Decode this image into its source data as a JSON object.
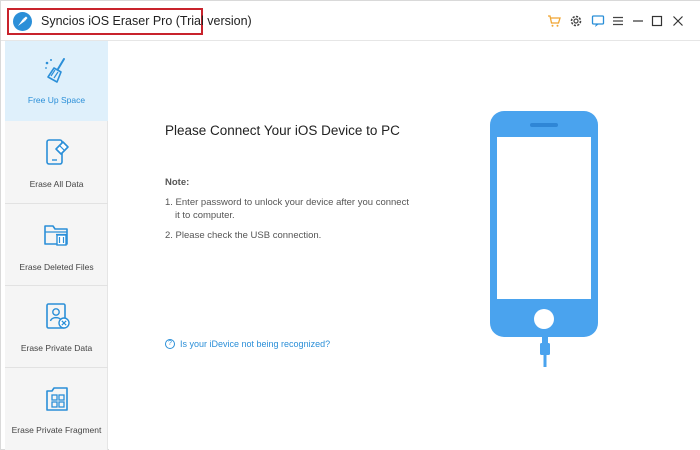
{
  "window": {
    "title": "Syncios iOS Eraser Pro (Trial version)"
  },
  "titlebar_icons": [
    "cart-icon",
    "gear-icon",
    "feedback-icon",
    "menu-icon",
    "minimize-icon",
    "maximize-icon",
    "close-icon"
  ],
  "sidebar": {
    "items": [
      {
        "label": "Free Up Space",
        "icon": "broom-icon",
        "active": true
      },
      {
        "label": "Erase All Data",
        "icon": "phone-eraser-icon",
        "active": false
      },
      {
        "label": "Erase Deleted Files",
        "icon": "folder-trash-icon",
        "active": false
      },
      {
        "label": "Erase Private Data",
        "icon": "private-doc-icon",
        "active": false
      },
      {
        "label": "Erase Private Fragment",
        "icon": "fragment-icon",
        "active": false
      }
    ]
  },
  "main": {
    "heading": "Please Connect Your iOS Device to PC",
    "note_title": "Note:",
    "notes": [
      "1. Enter password to unlock your device after you connect",
      "it to computer.",
      "2. Please check the USB connection."
    ],
    "help_link": "Is your iDevice not being recognized?"
  },
  "colors": {
    "accent": "#2b8fd8",
    "phone": "#4aa3ee",
    "highlight_border": "#c8232c",
    "sidebar_bg": "#f5f5f5",
    "sidebar_active_bg": "#dff0fb"
  }
}
